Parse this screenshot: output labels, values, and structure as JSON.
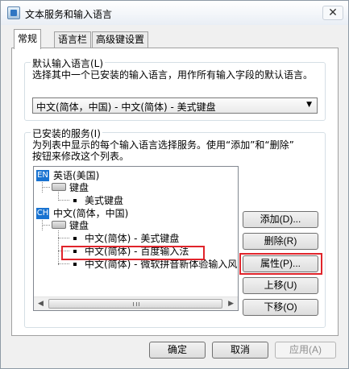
{
  "window": {
    "title": "文本服务和输入语言"
  },
  "tabs": [
    {
      "label": "常规"
    },
    {
      "label": "语言栏"
    },
    {
      "label": "高级键设置"
    }
  ],
  "default_lang": {
    "label": "默认输入语言(L)",
    "desc": "选择其中一个已安装的输入语言，用作所有输入字段的默认语言。",
    "selected": "中文(简体，中国) - 中文(简体) - 美式键盘"
  },
  "installed": {
    "label": "已安装的服务(I)",
    "desc_line1": "为列表中显示的每个输入语言选择服务。使用“添加”和“删除”",
    "desc_line2": "按钮来修改这个列表。",
    "tree": {
      "en_flag": "EN",
      "en_lang": "英语(美国)",
      "en_keyboard": "键盘",
      "en_kb_item": "美式键盘",
      "ch_flag": "CH",
      "ch_lang": "中文(简体，中国)",
      "ch_keyboard": "键盘",
      "ch_items": [
        "中文(简体) - 美式键盘",
        "中文(简体) - 百度输入法",
        "中文(简体) - 微软拼音新体验输入风"
      ]
    },
    "buttons": {
      "add": "添加(D)...",
      "remove": "删除(R)",
      "properties": "属性(P)...",
      "move_up": "上移(U)",
      "move_down": "下移(O)"
    }
  },
  "footer": {
    "ok": "确定",
    "cancel": "取消",
    "apply": "应用(A)"
  }
}
